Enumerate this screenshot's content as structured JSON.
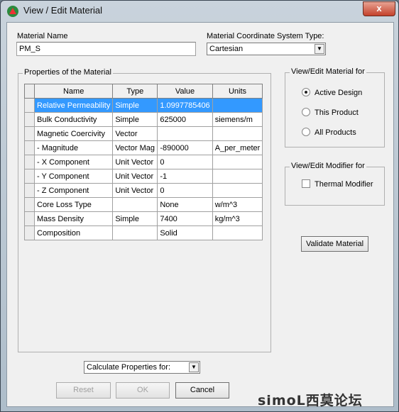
{
  "window": {
    "title": "View / Edit Material",
    "close_label": "x"
  },
  "material_name": {
    "label": "Material Name",
    "value": "PM_S"
  },
  "coord_system": {
    "label": "Material Coordinate System Type:",
    "value": "Cartesian"
  },
  "properties": {
    "label": "Properties of the Material",
    "columns": [
      "Name",
      "Type",
      "Value",
      "Units"
    ],
    "rows": [
      {
        "name": "Relative Permeability",
        "type": "Simple",
        "value": "1.0997785406",
        "units": "",
        "selected": true
      },
      {
        "name": "Bulk Conductivity",
        "type": "Simple",
        "value": "625000",
        "units": "siemens/m"
      },
      {
        "name": "Magnetic Coercivity",
        "type": "Vector",
        "value": "",
        "units": ""
      },
      {
        "name": "-  Magnitude",
        "type": "Vector Mag",
        "value": "-890000",
        "units": "A_per_meter"
      },
      {
        "name": "- X Component",
        "type": "Unit Vector",
        "value": "0",
        "units": ""
      },
      {
        "name": "- Y Component",
        "type": "Unit Vector",
        "value": "-1",
        "units": ""
      },
      {
        "name": "- Z Component",
        "type": "Unit Vector",
        "value": "0",
        "units": ""
      },
      {
        "name": "Core Loss Type",
        "type": "",
        "value": "None",
        "units": "w/m^3"
      },
      {
        "name": "Mass Density",
        "type": "Simple",
        "value": "7400",
        "units": "kg/m^3"
      },
      {
        "name": "Composition",
        "type": "",
        "value": "Solid",
        "units": ""
      }
    ]
  },
  "view_edit_for": {
    "label": "View/Edit Material for",
    "options": [
      "Active Design",
      "This Product",
      "All Products"
    ],
    "selected": "Active Design"
  },
  "modifier": {
    "label": "View/Edit Modifier for",
    "thermal": "Thermal Modifier",
    "checked": false
  },
  "validate_label": "Validate Material",
  "calculate": {
    "value": "Calculate Properties for:"
  },
  "buttons": {
    "reset": "Reset",
    "ok": "OK",
    "cancel": "Cancel"
  },
  "watermark": "simoL西莫论坛",
  "colors": {
    "selection": "#3399ff"
  }
}
